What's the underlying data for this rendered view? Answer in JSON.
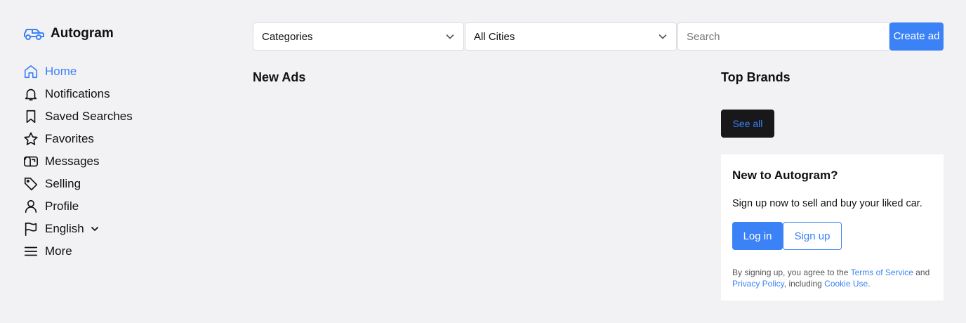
{
  "brand": {
    "name": "Autogram",
    "icon": "car-icon",
    "accent": "#3b82f6"
  },
  "sidebar": {
    "items": [
      {
        "label": "Home",
        "icon": "home-icon",
        "active": true
      },
      {
        "label": "Notifications",
        "icon": "bell-icon"
      },
      {
        "label": "Saved Searches",
        "icon": "bookmark-icon"
      },
      {
        "label": "Favorites",
        "icon": "star-icon"
      },
      {
        "label": "Messages",
        "icon": "mailbox-icon"
      },
      {
        "label": "Selling",
        "icon": "tag-icon"
      },
      {
        "label": "Profile",
        "icon": "user-icon"
      },
      {
        "label": "English",
        "icon": "flag-icon"
      },
      {
        "label": "More",
        "icon": "menu-icon"
      }
    ]
  },
  "toolbar": {
    "categories_value": "Categories",
    "city_value": "All Cities",
    "search_placeholder": "Search",
    "create_label": "Create ad"
  },
  "main": {
    "new_ads_title": "New Ads"
  },
  "aside": {
    "top_brands_title": "Top Brands",
    "see_all_label": "See all",
    "signup_card": {
      "title": "New to Autogram?",
      "text": "Sign up now to sell and buy your liked car.",
      "login_label": "Log in",
      "signup_label": "Sign up",
      "legal_prefix": "By signing up, you agree to the ",
      "terms_link": "Terms of Service",
      "legal_and": " and ",
      "privacy_link": "Privacy Policy",
      "legal_including": ", including ",
      "cookie_link": "Cookie Use",
      "legal_end": "."
    }
  }
}
